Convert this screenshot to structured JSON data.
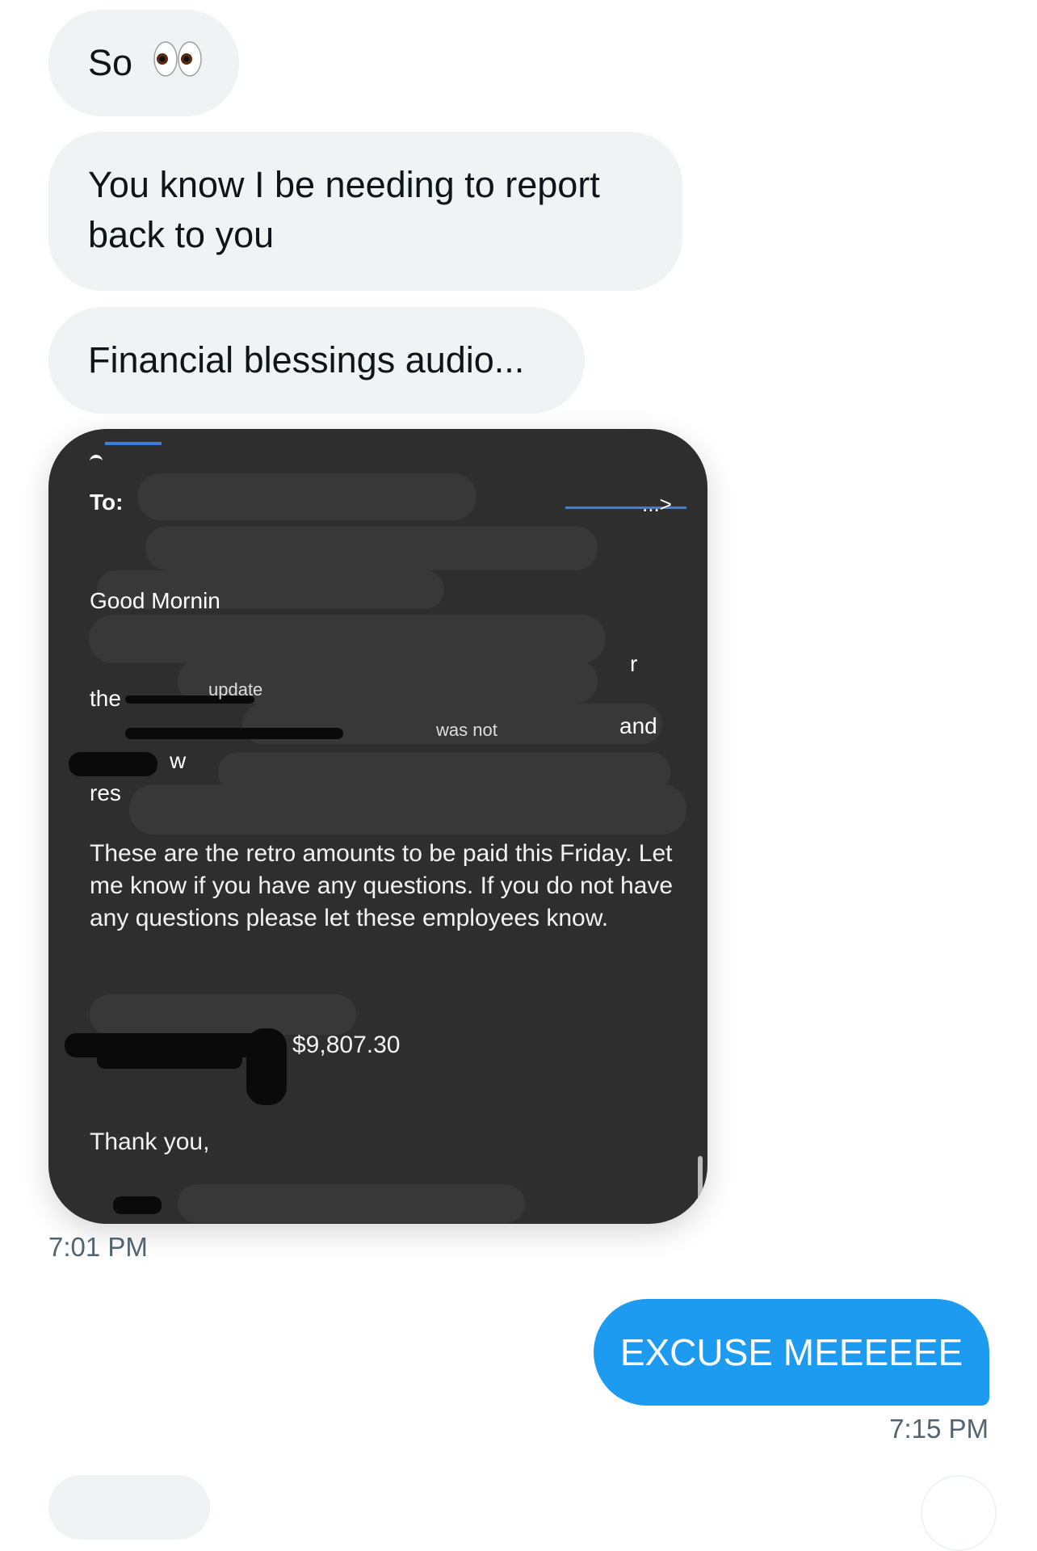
{
  "messages": {
    "m1": {
      "text": "So",
      "emoji": "eyes-emoji"
    },
    "m2": {
      "text": "You know I be needing to report back to you"
    },
    "m3": {
      "text": "Financial blessings audio..."
    },
    "image": {
      "to_label": "To:",
      "greeting_fragment": "Good Mornin",
      "fragment_the": "the",
      "fragment_update": "update",
      "fragment_was_not": "was not",
      "fragment_and": "and",
      "fragment_w": "w",
      "fragment_res": "res",
      "fragment_r": "r",
      "fragment_arrow": "...>",
      "body": "These are the retro amounts to be paid this Friday. Let me know if you have any questions. If you do not have any questions please let these employees know.",
      "amount": "$9,807.30",
      "signoff": "Thank you,"
    },
    "image_time": "7:01 PM",
    "reply": {
      "text": "EXCUSE MEEEEEE",
      "time": "7:15 PM"
    }
  },
  "colors": {
    "incoming_bubble": "#eff3f4",
    "outgoing_bubble": "#1d9bf0",
    "card": "#2e2e2f",
    "timestamp": "#536471"
  }
}
